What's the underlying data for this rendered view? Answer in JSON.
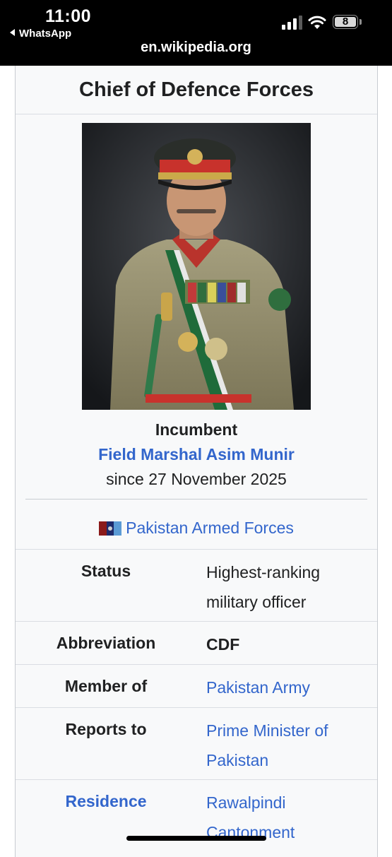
{
  "status_bar": {
    "time": "11:00",
    "back_app": "WhatsApp",
    "url": "en.wikipedia.org",
    "battery": "8"
  },
  "infobox": {
    "title": "Chief of Defence Forces",
    "incumbent_label": "Incumbent",
    "incumbent_name": "Field Marshal Asim Munir",
    "incumbent_since": "since 27 November 2025",
    "forces_link": "Pakistan Armed Forces",
    "rows": [
      {
        "label": "Status",
        "value_lines": [
          "Highest-ranking",
          "military officer"
        ]
      },
      {
        "label": "Abbreviation",
        "value_lines": [
          "CDF"
        ]
      },
      {
        "label": "Member of",
        "value_lines": [
          "Pakistan Army"
        ]
      },
      {
        "label": "Reports to",
        "value_lines": [
          "Prime Minister of",
          "Pakistan"
        ]
      },
      {
        "label": "Residence",
        "value_lines": [
          "Rawalpindi",
          "Cantonment"
        ]
      }
    ]
  },
  "colors": {
    "link": "#3366cc",
    "text": "#202122",
    "infobox_bg": "#f8f9fa",
    "border": "#c8ccd1"
  }
}
